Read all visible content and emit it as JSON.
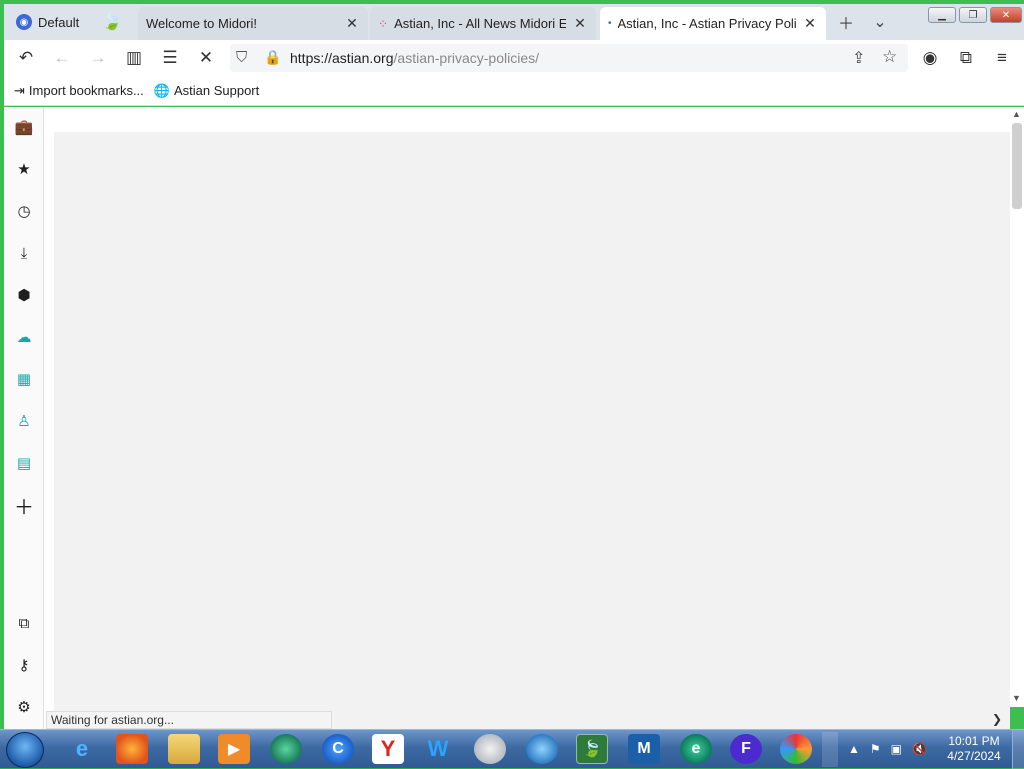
{
  "window": {
    "frame_color": "#3cbf4e"
  },
  "tabbar": {
    "profile_label": "Default",
    "tabs": [
      {
        "title": "Welcome to Midori!",
        "active": false
      },
      {
        "title": "Astian, Inc - All News Midori Eng",
        "active": false
      },
      {
        "title": "Astian, Inc - Astian Privacy Polic",
        "active": true
      }
    ]
  },
  "navbar": {
    "url_host": "https://astian.org",
    "url_path": "/astian-privacy-policies/"
  },
  "bookmarks": [
    {
      "label": "Import bookmarks...",
      "icon": "import-icon"
    },
    {
      "label": "Astian Support",
      "icon": "globe-icon"
    }
  ],
  "status": {
    "text": "Waiting for astian.org..."
  },
  "taskbar": {
    "clock_time": "10:01 PM",
    "clock_date": "4/27/2024"
  }
}
